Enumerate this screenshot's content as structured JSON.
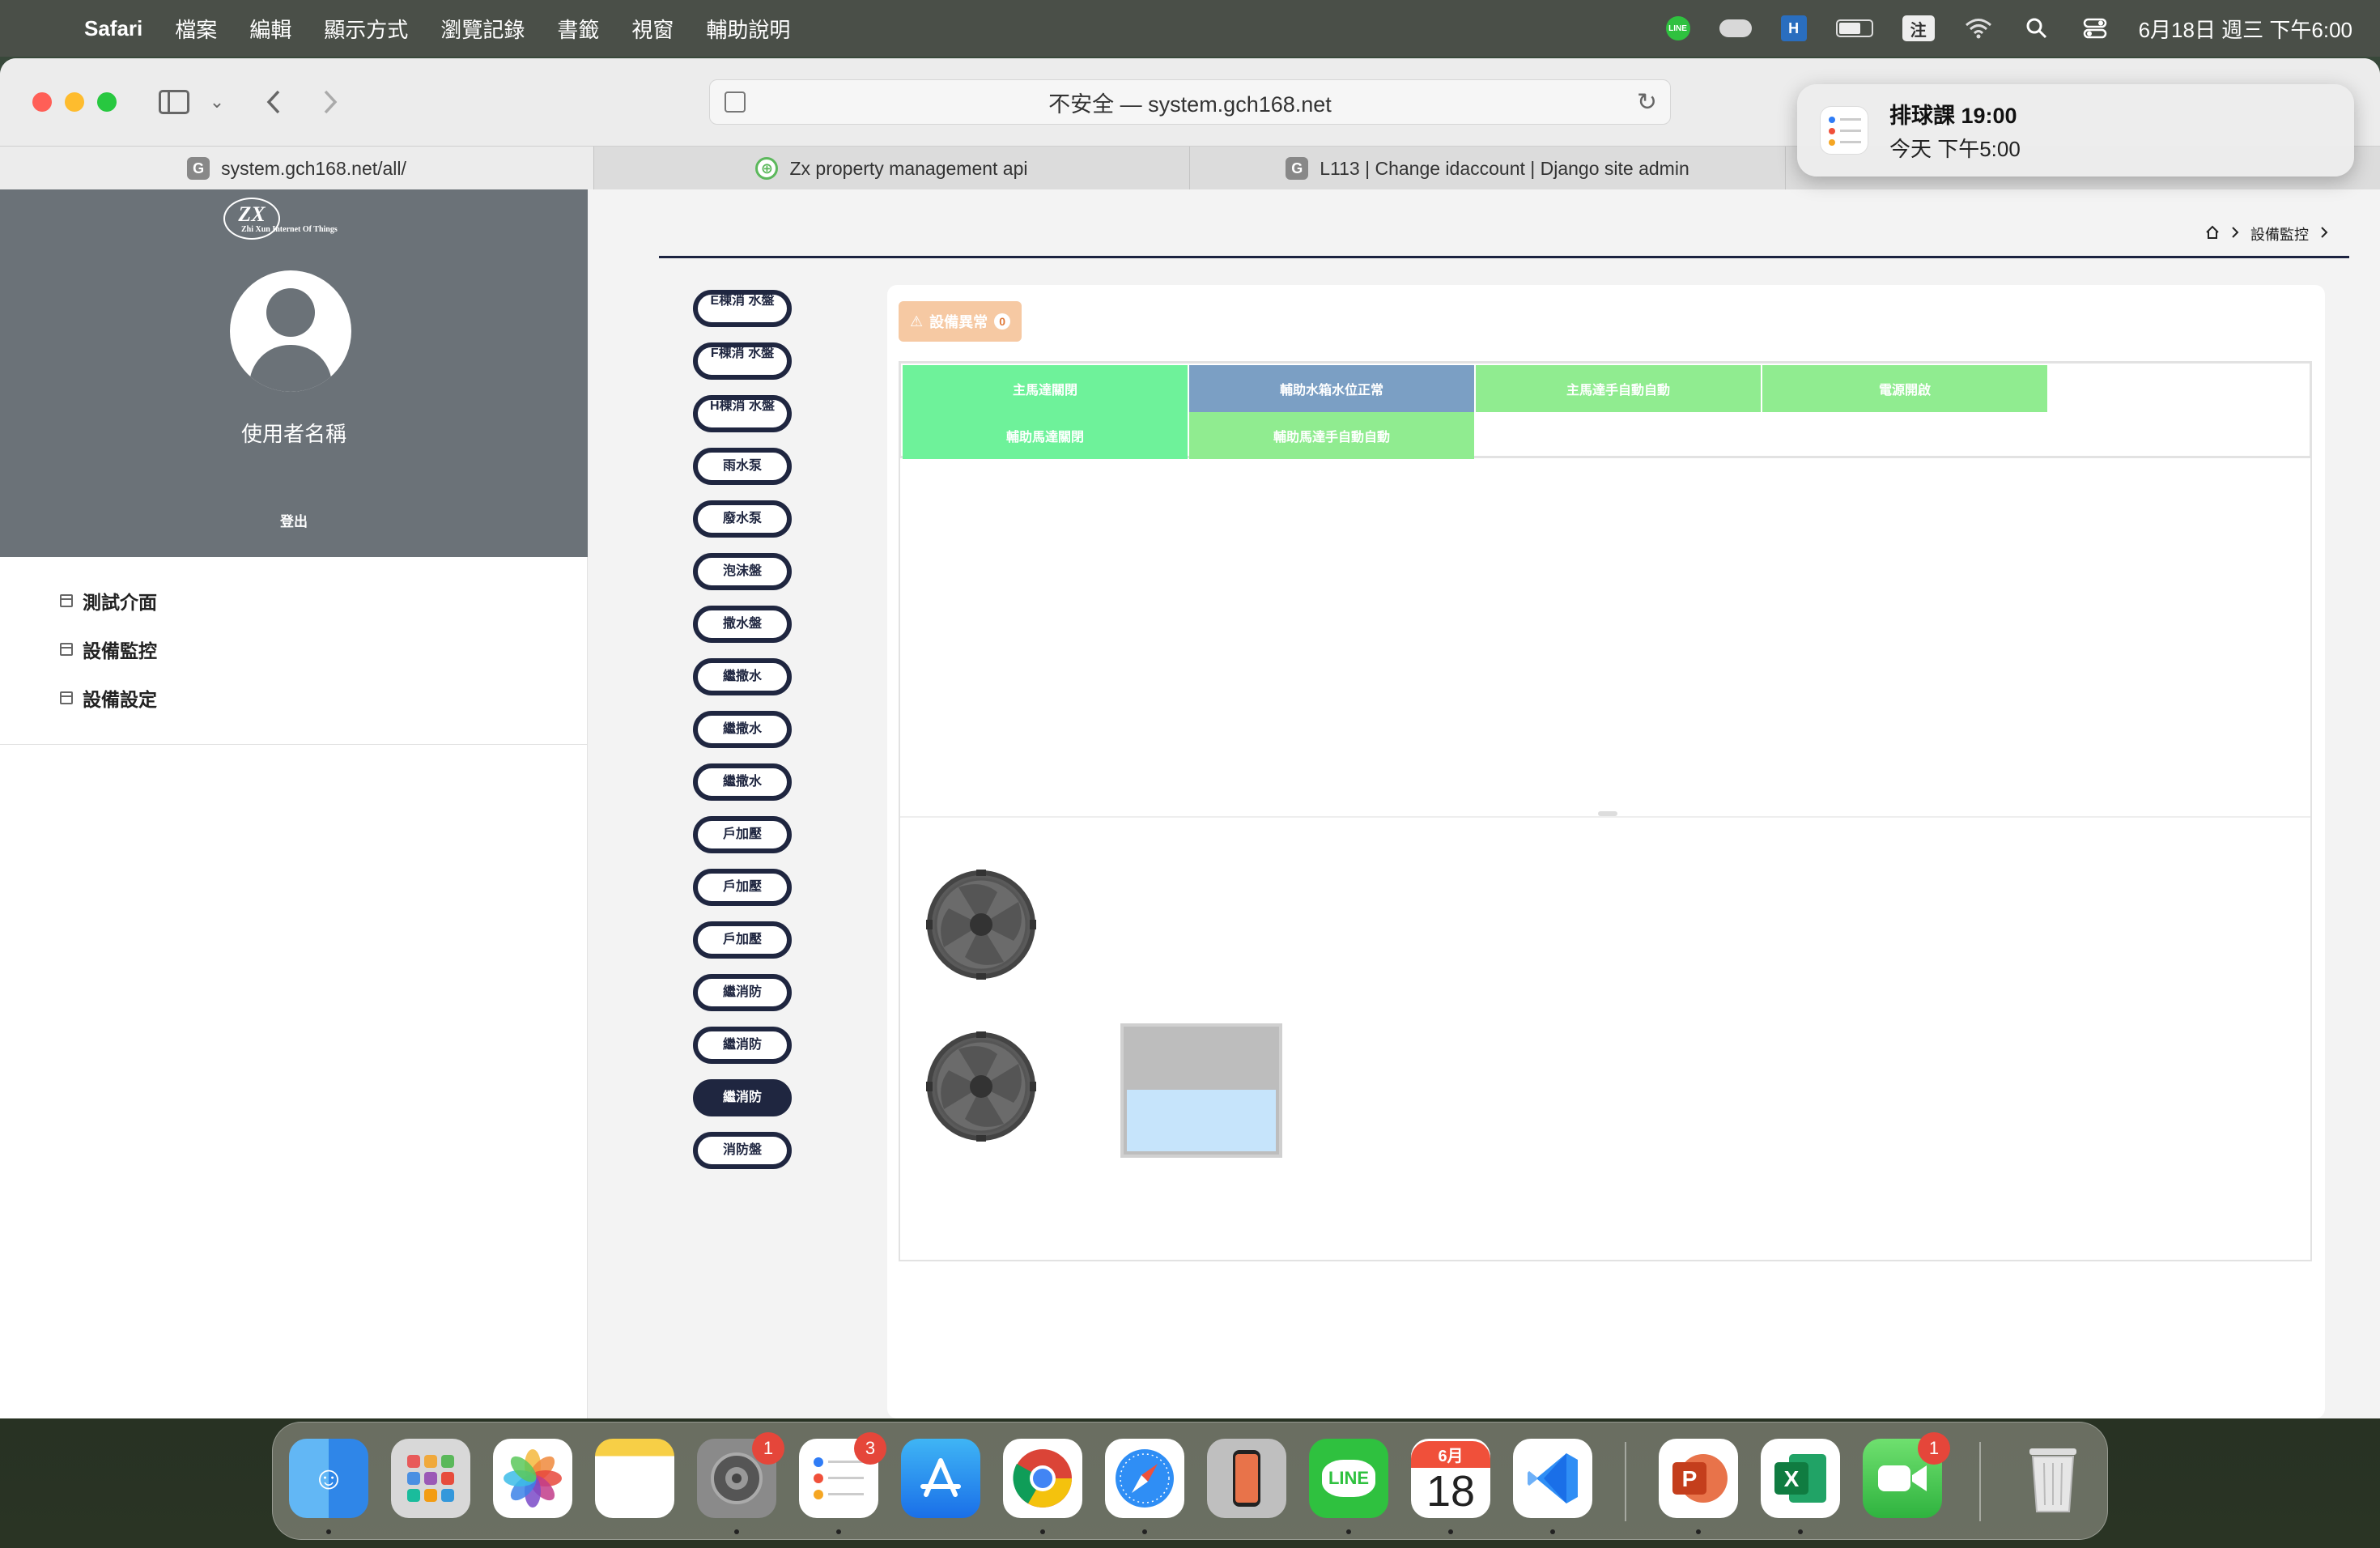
{
  "menubar": {
    "app": "Safari",
    "items": [
      "檔案",
      "編輯",
      "顯示方式",
      "瀏覽記錄",
      "書籤",
      "視窗",
      "輔助說明"
    ],
    "status": {
      "line_icon_text": "LINE",
      "ime": "注",
      "datetime": "6月18日 週三 下午6:00"
    }
  },
  "browser": {
    "url": "不安全 — system.gch168.net",
    "tabs": [
      {
        "favicon": "G",
        "label": "system.gch168.net/all/"
      },
      {
        "favicon": "⊕",
        "label": "Zx property management api"
      },
      {
        "favicon": "G",
        "label": "L113 | Change idaccount | Django site admin"
      }
    ]
  },
  "notification": {
    "title": "排球課 19:00",
    "body": "今天 下午5:00"
  },
  "sidebar": {
    "logo_text": "ZX",
    "logo_sub": "Zhi Xun Internet Of Things",
    "username": "使用者名稱",
    "logout": "登出",
    "nav": [
      "測試介面",
      "設備監控",
      "設備設定"
    ]
  },
  "breadcrumb": {
    "current": "設備監控"
  },
  "pills": [
    {
      "label": "E棟消 水盤",
      "style": "clip"
    },
    {
      "label": "F棟消 水盤",
      "style": "clip"
    },
    {
      "label": "H棟消 水盤",
      "style": "clip"
    },
    {
      "label": "雨水泵",
      "style": "normal"
    },
    {
      "label": "廢水泵",
      "style": "normal"
    },
    {
      "label": "泡沫盤",
      "style": "normal"
    },
    {
      "label": "撒水盤",
      "style": "normal"
    },
    {
      "label": "繼撒水",
      "style": "normal"
    },
    {
      "label": "繼撒水",
      "style": "normal"
    },
    {
      "label": "繼撒水",
      "style": "normal"
    },
    {
      "label": "戶加壓",
      "style": "normal"
    },
    {
      "label": "戶加壓",
      "style": "normal"
    },
    {
      "label": "戶加壓",
      "style": "normal"
    },
    {
      "label": "繼消防",
      "style": "normal"
    },
    {
      "label": "繼消防",
      "style": "normal"
    },
    {
      "label": "繼消防",
      "style": "dark"
    },
    {
      "label": "消防盤",
      "style": "normal"
    }
  ],
  "panel": {
    "warning_label": "設備異常",
    "warning_count": "0",
    "status_cells": [
      {
        "label": "主馬達關閉",
        "color": "#6ef29a"
      },
      {
        "label": "輔助水箱水位正常",
        "color": "#7b9fc4"
      },
      {
        "label": "主馬達手自動自動",
        "color": "#90ec90"
      },
      {
        "label": "電源開啟",
        "color": "#90ec90"
      },
      {
        "label": "輔助馬達關閉",
        "color": "#6ef29a"
      },
      {
        "label": "輔助馬達手自動自動",
        "color": "#90ec90"
      }
    ]
  },
  "dock": {
    "badges": {
      "settings": "1",
      "reminders": "3",
      "facetime": "1"
    },
    "calendar_month": "6月",
    "calendar_day": "18",
    "line_label": "LINE"
  }
}
